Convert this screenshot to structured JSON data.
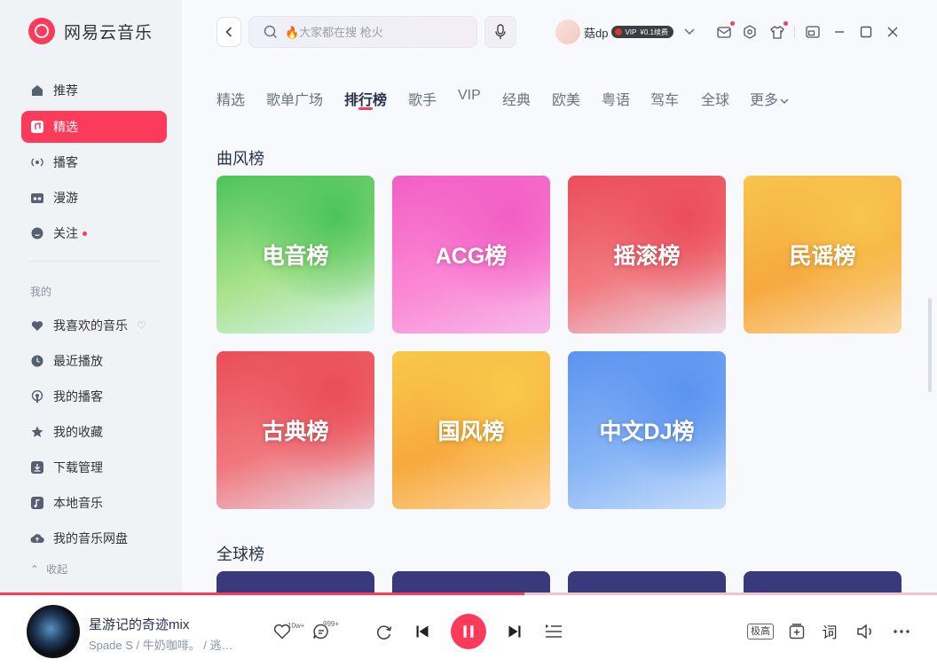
{
  "app": {
    "name": "网易云音乐"
  },
  "sidebar": {
    "items": [
      {
        "label": "推荐"
      },
      {
        "label": "精选"
      },
      {
        "label": "播客"
      },
      {
        "label": "漫游"
      },
      {
        "label": "关注"
      }
    ],
    "my_section_label": "我的",
    "my_items": [
      {
        "label": "我喜欢的音乐"
      },
      {
        "label": "最近播放"
      },
      {
        "label": "我的播客"
      },
      {
        "label": "我的收藏"
      },
      {
        "label": "下载管理"
      },
      {
        "label": "本地音乐"
      },
      {
        "label": "我的音乐网盘"
      }
    ],
    "collapse_label": "收起"
  },
  "header": {
    "search_placeholder": "🔥大家都在搜 枪火",
    "username": "菇dp",
    "vip_label": "VIP",
    "vip_price": "¥0.1续费"
  },
  "tabs": [
    "精选",
    "歌单广场",
    "排行榜",
    "歌手",
    "VIP",
    "经典",
    "欧美",
    "粤语",
    "驾车",
    "全球",
    "更多"
  ],
  "sections": [
    {
      "title": "曲风榜",
      "cards": [
        {
          "label": "电音榜",
          "colors": [
            "#4cc45a",
            "#a8e28a",
            "#d6f2ee"
          ]
        },
        {
          "label": "ACG榜",
          "colors": [
            "#f25ec4",
            "#fb86d3",
            "#f7b9ea"
          ]
        },
        {
          "label": "摇滚榜",
          "colors": [
            "#eb4d59",
            "#f27a80",
            "#e9dbe6"
          ]
        },
        {
          "label": "民谣榜",
          "colors": [
            "#f7c54d",
            "#f6a93f",
            "#fbd9a6"
          ]
        },
        {
          "label": "古典榜",
          "colors": [
            "#ea4d56",
            "#f1777d",
            "#e6dce6"
          ]
        },
        {
          "label": "国风榜",
          "colors": [
            "#f8c94a",
            "#f7a93d",
            "#fdd7a1"
          ]
        },
        {
          "label": "中文DJ榜",
          "colors": [
            "#5b93f0",
            "#86b4f5",
            "#c4dcfb"
          ]
        }
      ]
    },
    {
      "title": "全球榜"
    }
  ],
  "player": {
    "song_title": "星游记的奇迹mix",
    "song_artist": "Spade S / 牛奶咖啡。 / 逃…",
    "like_count": "10w+",
    "comment_count": "999+",
    "quality_label": "极高",
    "lyrics_label": "词",
    "progress": 0.56
  },
  "colors": {
    "accent": "#fc3b5b",
    "sidebar_bg": "#f0f3f6"
  }
}
